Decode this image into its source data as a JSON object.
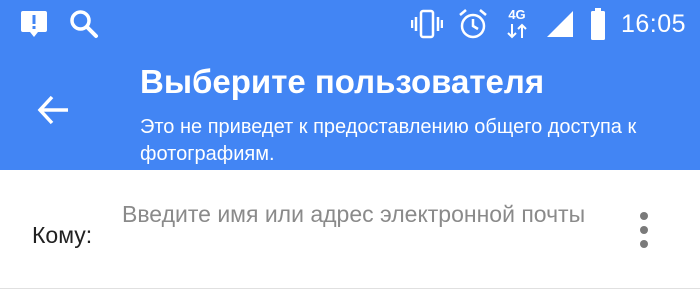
{
  "status_bar": {
    "time": "16:05",
    "network_label": "4G",
    "left_icons": [
      "alert-icon",
      "search-icon"
    ],
    "right_icons": [
      "vibrate-icon",
      "alarm-icon",
      "network-4g-icon",
      "signal-icon",
      "battery-icon"
    ]
  },
  "app_bar": {
    "title": "Выберите пользователя",
    "subtitle": "Это не приведет к предоставлению общего доступа к фотографиям.",
    "back_icon": "arrow-back-icon",
    "background_color": "#4285f4"
  },
  "recipient": {
    "label": "Кому:",
    "value": "",
    "placeholder": "Введите имя или адрес электронной почты",
    "menu_icon": "more-vert-icon"
  }
}
